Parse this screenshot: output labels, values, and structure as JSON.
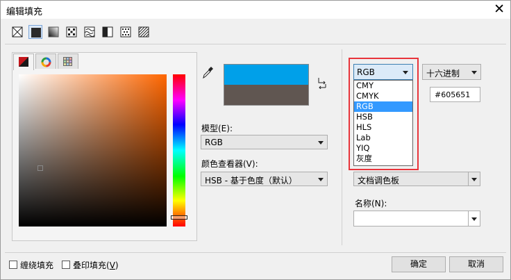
{
  "window": {
    "title": "编辑填充",
    "close_glyph": "✕"
  },
  "fill_types": [
    {
      "name": "no-fill-icon"
    },
    {
      "name": "uniform-fill-icon",
      "selected": true
    },
    {
      "name": "fountain-fill-icon"
    },
    {
      "name": "vector-pattern-icon"
    },
    {
      "name": "bitmap-pattern-icon"
    },
    {
      "name": "two-color-pattern-icon"
    },
    {
      "name": "texture-fill-icon"
    },
    {
      "name": "postscript-fill-icon"
    }
  ],
  "picker_tabs": [
    {
      "name": "color-model-tab-icon",
      "active": true
    },
    {
      "name": "color-harmonies-tab-icon"
    },
    {
      "name": "color-palette-tab-icon"
    }
  ],
  "colors": {
    "new_color": "#00A0E9",
    "old_color": "#605651",
    "base_hue": "#FF6600",
    "highlight": "#E8343A"
  },
  "model": {
    "label": "模型(E):",
    "value": "RGB"
  },
  "viewer": {
    "label": "颜色查看器(V):",
    "value": "HSB - 基于色度（默认）"
  },
  "color_model_dropdown": {
    "value": "RGB",
    "options": [
      "CMY",
      "CMYK",
      "RGB",
      "HSB",
      "HLS",
      "Lab",
      "YIQ",
      "灰度"
    ],
    "selected_index": 2
  },
  "hex_format": {
    "value": "十六进制"
  },
  "hex_value": "#605651",
  "palette": {
    "value": "文档调色板"
  },
  "name_field": {
    "label": "名称(N):",
    "value": ""
  },
  "footer": {
    "wrap_fill_label": "缠绕填充",
    "overprint_label_main": "叠印填充(",
    "overprint_label_key": "V",
    "overprint_label_end": ")",
    "ok_label": "确定",
    "cancel_label": "取消"
  }
}
